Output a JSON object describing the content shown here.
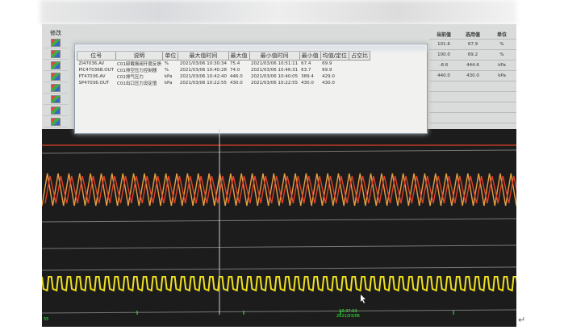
{
  "edit_header": "修改",
  "edit_rows": 8,
  "table": {
    "headers": [
      "位号",
      "说明",
      "单位",
      "最大值时间",
      "最大值",
      "最小值时间",
      "最小值",
      "均值/定位",
      "占空比"
    ],
    "rows": [
      [
        "ZI47036.AV",
        "C01卸载振阀开度反馈",
        "%",
        "2021/03/06 10:30:34",
        "75.4",
        "2021/03/06 10:51:11",
        "67.4",
        "69.9",
        ""
      ],
      [
        "PIC47036B.OUT",
        "C01排空压力控制器",
        "%",
        "2021/03/06 10:40:28",
        "74.0",
        "2021/03/06 10:46:31",
        "63.7",
        "69.9",
        ""
      ],
      [
        "PT47036.AV",
        "C01排气压力",
        "kPa",
        "2021/03/06 10:42:40",
        "446.0",
        "2021/03/06 10:40:05",
        "389.4",
        "429.0",
        ""
      ],
      [
        "SP47036.OUT",
        "C01出口压力设定值",
        "kPa",
        "2021/03/06 10:22:55",
        "430.0",
        "2021/03/06 10:22:55",
        "430.0",
        "430.0",
        ""
      ]
    ]
  },
  "right_panel": {
    "headers": [
      "当前值",
      "选用值",
      "单位"
    ],
    "rows": [
      [
        "101.6",
        "67.9",
        "%"
      ],
      [
        "100.0",
        "69.2",
        "%"
      ],
      [
        "-8.6",
        "444.6",
        "kPa"
      ],
      [
        "440.0",
        "430.0",
        "kPa"
      ]
    ]
  },
  "trend": {
    "time": "10:37:03",
    "date": "2021/03/06",
    "left_label": "55",
    "colors": {
      "red": "#e0402a",
      "orange": "#e8a040",
      "yellow": "#f0e020",
      "cursor": "#cccccc"
    }
  }
}
